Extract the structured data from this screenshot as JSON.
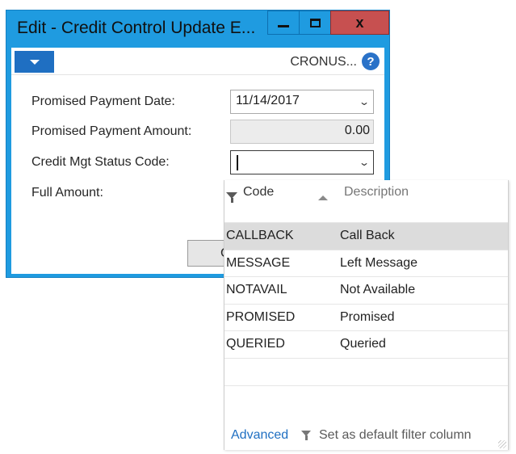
{
  "window": {
    "title": "Edit - Credit Control Update E...",
    "close_glyph": "x"
  },
  "actionbar": {
    "company": "CRONUS...",
    "help_glyph": "?"
  },
  "form": {
    "promised_payment_date": {
      "label": "Promised Payment Date:",
      "value": "11/14/2017"
    },
    "promised_payment_amount": {
      "label": "Promised Payment Amount:",
      "value": "0.00"
    },
    "credit_mgt_status_code": {
      "label": "Credit Mgt Status Code:",
      "value": ""
    },
    "full_amount": {
      "label": "Full Amount:"
    },
    "ok_button_visible_text": "C"
  },
  "lookup": {
    "columns": {
      "code": "Code",
      "description": "Description"
    },
    "rows": [
      {
        "code": "CALLBACK",
        "description": "Call Back",
        "selected": true
      },
      {
        "code": "MESSAGE",
        "description": "Left Message"
      },
      {
        "code": "NOTAVAIL",
        "description": "Not Available"
      },
      {
        "code": "PROMISED",
        "description": "Promised"
      },
      {
        "code": "QUERIED",
        "description": "Queried"
      }
    ],
    "footer": {
      "advanced": "Advanced",
      "default_filter": "Set as default filter column"
    }
  },
  "colors": {
    "window_frame": "#1f9be0",
    "close_button": "#c75050",
    "accent_blue": "#1f6fc2",
    "selected_row": "#dcdcdc"
  },
  "icons": [
    "chevron-down-icon",
    "help-icon",
    "filter-icon",
    "sort-ascending-icon",
    "minimize-icon",
    "maximize-icon",
    "close-icon"
  ]
}
